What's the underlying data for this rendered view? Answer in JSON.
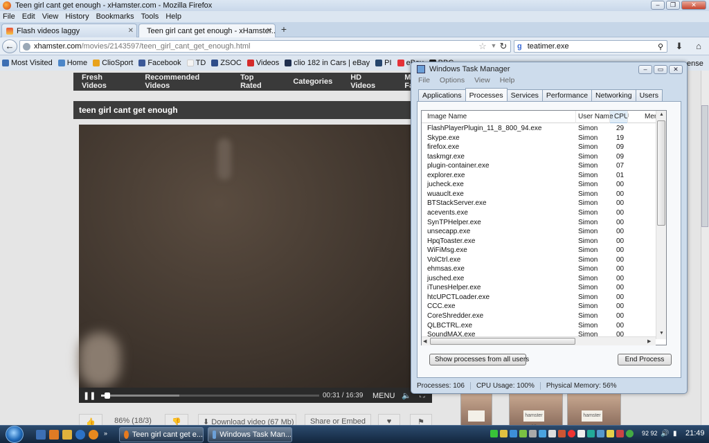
{
  "window": {
    "title": "Teen girl cant get enough - xHamster.com - Mozilla Firefox"
  },
  "menubar": [
    "File",
    "Edit",
    "View",
    "History",
    "Bookmarks",
    "Tools",
    "Help"
  ],
  "tabs": [
    {
      "label": "Flash videos laggy",
      "active": false
    },
    {
      "label": "Teen girl cant get enough - xHamster...",
      "active": true
    }
  ],
  "url": {
    "domain": "xhamster.com",
    "path": "/movies/2143597/teen_girl_cant_get_enough.html"
  },
  "search": {
    "value": "teatimer.exe"
  },
  "bookmarks": [
    {
      "label": "Most Visited",
      "color": "#3c6fb4"
    },
    {
      "label": "Home",
      "color": "#4b86c8"
    },
    {
      "label": "ClioSport",
      "color": "#e8a21c"
    },
    {
      "label": "Facebook",
      "color": "#3b5998"
    },
    {
      "label": "TD",
      "color": "#f4f4f4"
    },
    {
      "label": "ZSOC",
      "color": "#2e4d8a"
    },
    {
      "label": "Videos",
      "color": "#d42b2b"
    },
    {
      "label": "clio 182 in Cars | eBay",
      "color": "#1e2e4e"
    },
    {
      "label": "PI",
      "color": "#26466d"
    },
    {
      "label": "eBay",
      "color": "#e53238"
    },
    {
      "label": "BBC",
      "color": "#222"
    }
  ],
  "bookmarks_clipped": "ense",
  "site": {
    "nav": [
      "Fresh Videos",
      "Recommended Videos",
      "Top Rated",
      "Categories",
      "HD Videos",
      "My Favo"
    ],
    "video_title": "teen girl cant get enough",
    "player": {
      "time": "00:31 / 16:39",
      "menu": "MENU",
      "progress": 0.03,
      "buffered": 0.36
    },
    "actions": {
      "rating": "86% (18/3)",
      "download": "Download video (67 Mb)",
      "share": "Share or Embed"
    },
    "thumb_notes": [
      "",
      "hamster 18",
      "hamster"
    ]
  },
  "taskmanager": {
    "title": "Windows Task Manager",
    "menu": [
      "File",
      "Options",
      "View",
      "Help"
    ],
    "tabs": [
      "Applications",
      "Processes",
      "Services",
      "Performance",
      "Networking",
      "Users"
    ],
    "active_tab": "Processes",
    "columns": [
      "Image Name",
      "User Name",
      "CPU",
      "Mem"
    ],
    "processes": [
      {
        "name": "FlashPlayerPlugin_11_8_800_94.exe",
        "user": "Simon",
        "cpu": "29"
      },
      {
        "name": "Skype.exe",
        "user": "Simon",
        "cpu": "19"
      },
      {
        "name": "firefox.exe",
        "user": "Simon",
        "cpu": "09"
      },
      {
        "name": "taskmgr.exe",
        "user": "Simon",
        "cpu": "09"
      },
      {
        "name": "plugin-container.exe",
        "user": "Simon",
        "cpu": "07"
      },
      {
        "name": "explorer.exe",
        "user": "Simon",
        "cpu": "01"
      },
      {
        "name": "jucheck.exe",
        "user": "Simon",
        "cpu": "00"
      },
      {
        "name": "wuauclt.exe",
        "user": "Simon",
        "cpu": "00"
      },
      {
        "name": "BTStackServer.exe",
        "user": "Simon",
        "cpu": "00"
      },
      {
        "name": "acevents.exe",
        "user": "Simon",
        "cpu": "00"
      },
      {
        "name": "SynTPHelper.exe",
        "user": "Simon",
        "cpu": "00"
      },
      {
        "name": "unsecapp.exe",
        "user": "Simon",
        "cpu": "00"
      },
      {
        "name": "HpqToaster.exe",
        "user": "Simon",
        "cpu": "00"
      },
      {
        "name": "WiFiMsg.exe",
        "user": "Simon",
        "cpu": "00"
      },
      {
        "name": "VolCtrl.exe",
        "user": "Simon",
        "cpu": "00"
      },
      {
        "name": "ehmsas.exe",
        "user": "Simon",
        "cpu": "00"
      },
      {
        "name": "jusched.exe",
        "user": "Simon",
        "cpu": "00"
      },
      {
        "name": "iTunesHelper.exe",
        "user": "Simon",
        "cpu": "00"
      },
      {
        "name": "htcUPCTLoader.exe",
        "user": "Simon",
        "cpu": "00"
      },
      {
        "name": "CCC.exe",
        "user": "Simon",
        "cpu": "00"
      },
      {
        "name": "CoreShredder.exe",
        "user": "Simon",
        "cpu": "00"
      },
      {
        "name": "QLBCTRL.exe",
        "user": "Simon",
        "cpu": "00"
      },
      {
        "name": "SoundMAX.exe",
        "user": "Simon",
        "cpu": "00"
      }
    ],
    "show_all_button": "Show processes from all users",
    "end_process_button": "End Process",
    "status": {
      "processes": "Processes: 106",
      "cpu": "CPU Usage: 100%",
      "memory": "Physical Memory: 56%"
    }
  },
  "taskbar": {
    "buttons": [
      {
        "label": "Teen girl cant get e...",
        "color": "#e67a1e"
      },
      {
        "label": "Windows Task Man...",
        "color": "#6ca0d8"
      }
    ],
    "tray_text": "92 92",
    "clock": "21:49"
  }
}
